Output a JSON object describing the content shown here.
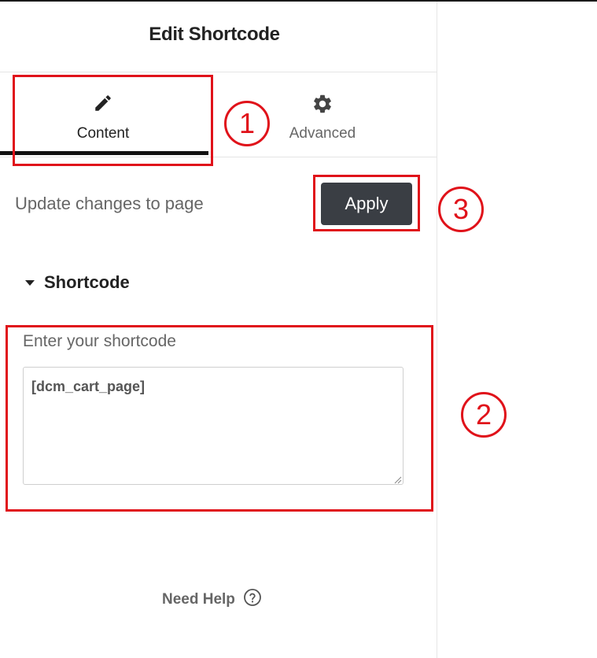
{
  "panel": {
    "title": "Edit Shortcode",
    "tabs": [
      {
        "label": "Content",
        "icon": "pencil-icon",
        "active": true
      },
      {
        "label": "Advanced",
        "icon": "gear-icon",
        "active": false
      }
    ],
    "update_text": "Update changes to page",
    "apply_label": "Apply",
    "section": {
      "title": "Shortcode",
      "field_label": "Enter your shortcode",
      "field_value": "[dcm_cart_page]"
    },
    "help_label": "Need Help",
    "help_icon": "question-circle-icon"
  },
  "annotations": {
    "step1": "1",
    "step2": "2",
    "step3": "3",
    "color": "#e0121a"
  },
  "colors": {
    "apply_bg": "#3a3e44",
    "active_tab_underline": "#111111"
  }
}
